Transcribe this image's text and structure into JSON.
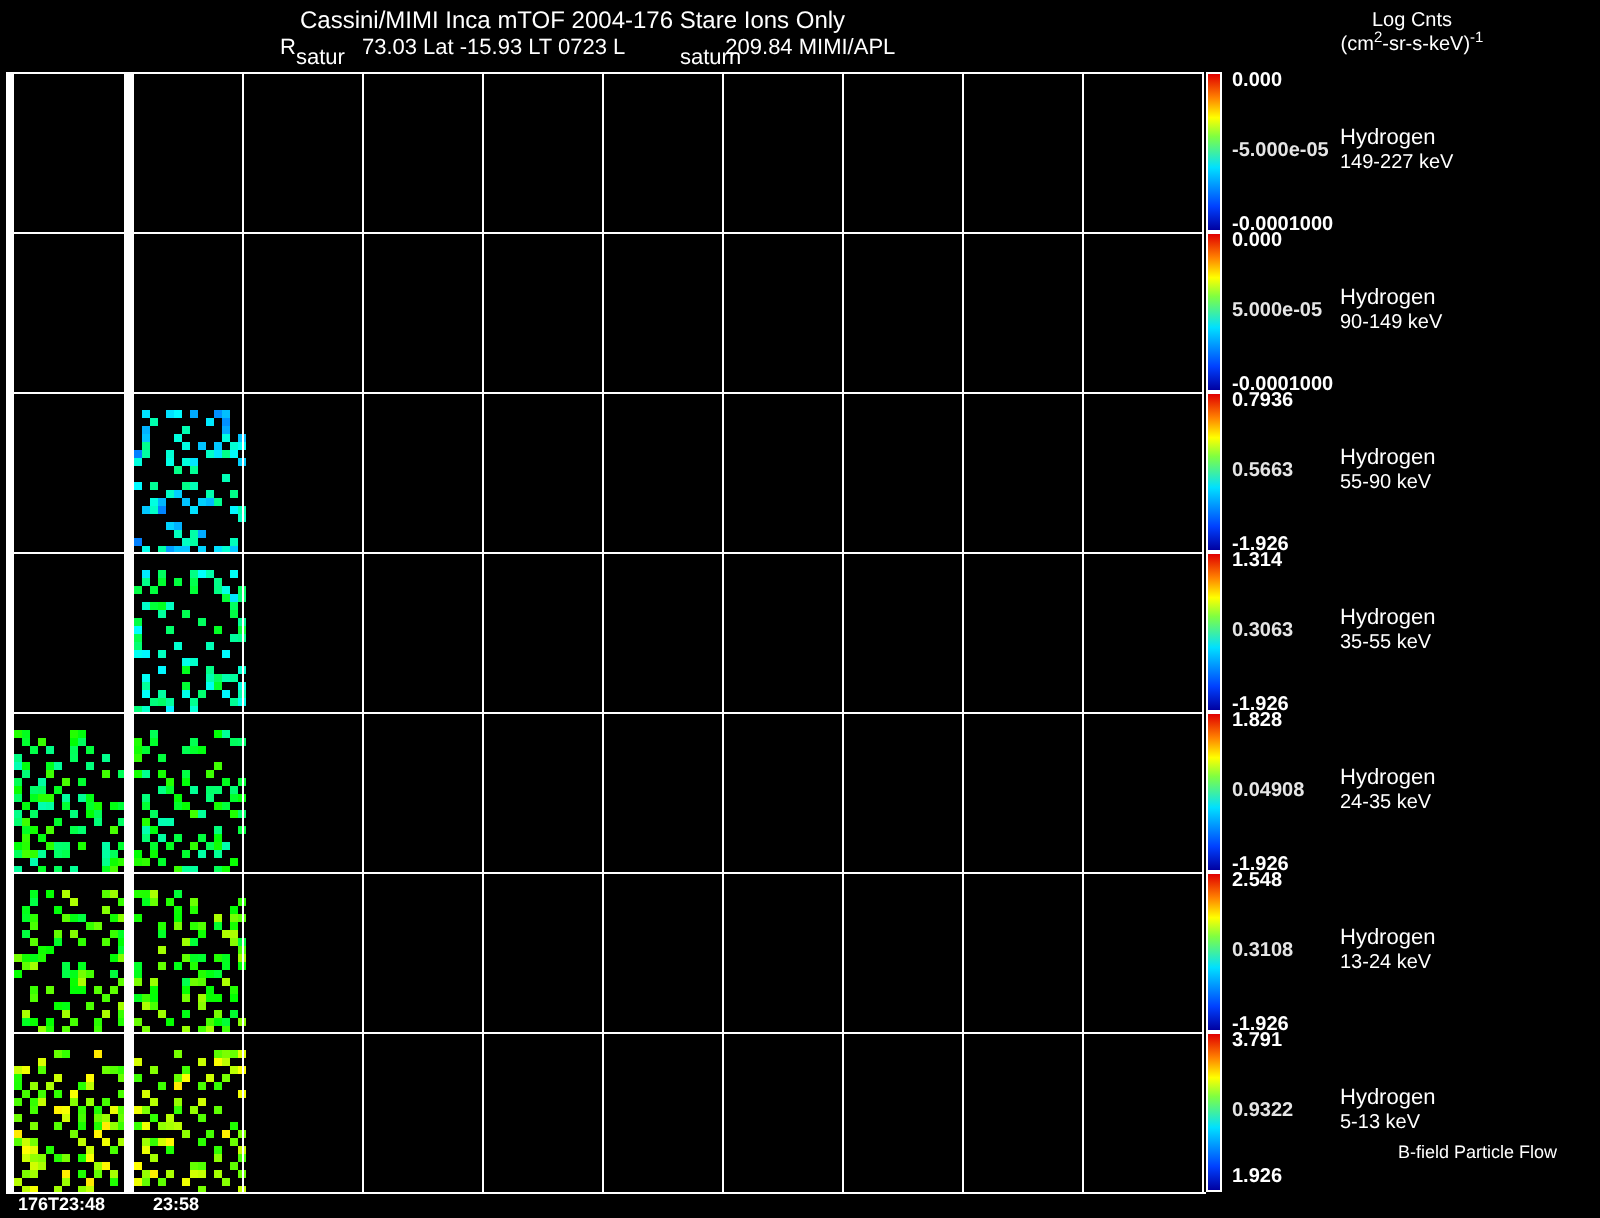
{
  "header": {
    "title": "Cassini/MIMI Inca mTOF  2004-176   Stare   Ions Only",
    "orbit_r": "R",
    "orbit_values": "73.03 Lat -15.93 LT 0723 L",
    "orbit_l": "209.84  MIMI/APL",
    "overlay_left": "satur",
    "overlay_right": "saturn",
    "units_title": "Log Cnts",
    "units": "(cm$^{2}$-sr-s-keV)$^{-1}$"
  },
  "panels": [
    {
      "species": "Hydrogen",
      "energy": "149-227 keV",
      "scale_max": "0.000",
      "scale_mid": "-5.000e-05",
      "scale_min": "-0.0001000",
      "data": [
        {
          "shown": false
        },
        {
          "shown": false
        }
      ]
    },
    {
      "species": "Hydrogen",
      "energy": "90-149 keV",
      "scale_max": "0.000",
      "scale_mid": "5.000e-05",
      "scale_min": "-0.0001000",
      "data": [
        {
          "shown": false
        },
        {
          "shown": false
        }
      ]
    },
    {
      "species": "Hydrogen",
      "energy": "55-90 keV",
      "scale_max": "0.7936",
      "scale_mid": "0.5663",
      "scale_min": "-1.926",
      "data": [
        {
          "shown": false
        },
        {
          "shown": true
        }
      ]
    },
    {
      "species": "Hydrogen",
      "energy": "35-55 keV",
      "scale_max": "1.314",
      "scale_mid": "0.3063",
      "scale_min": "-1.926",
      "data": [
        {
          "shown": false
        },
        {
          "shown": true
        }
      ]
    },
    {
      "species": "Hydrogen",
      "energy": "24-35 keV",
      "scale_max": "1.828",
      "scale_mid": "0.04908",
      "scale_min": "-1.926",
      "data": [
        {
          "shown": true
        },
        {
          "shown": true
        }
      ]
    },
    {
      "species": "Hydrogen",
      "energy": "13-24 keV",
      "scale_max": "2.548",
      "scale_mid": "0.3108",
      "scale_min": "-1.926",
      "data": [
        {
          "shown": true
        },
        {
          "shown": true
        }
      ]
    },
    {
      "species": "Hydrogen",
      "energy": "5-13 keV",
      "scale_max": "3.791",
      "scale_mid": "0.9322",
      "scale_min": "1.926",
      "data": [
        {
          "shown": true
        },
        {
          "shown": true
        }
      ]
    }
  ],
  "footnote": "B-field Particle Flow",
  "time_labels": [
    "176T23:48",
    "23:58"
  ]
}
